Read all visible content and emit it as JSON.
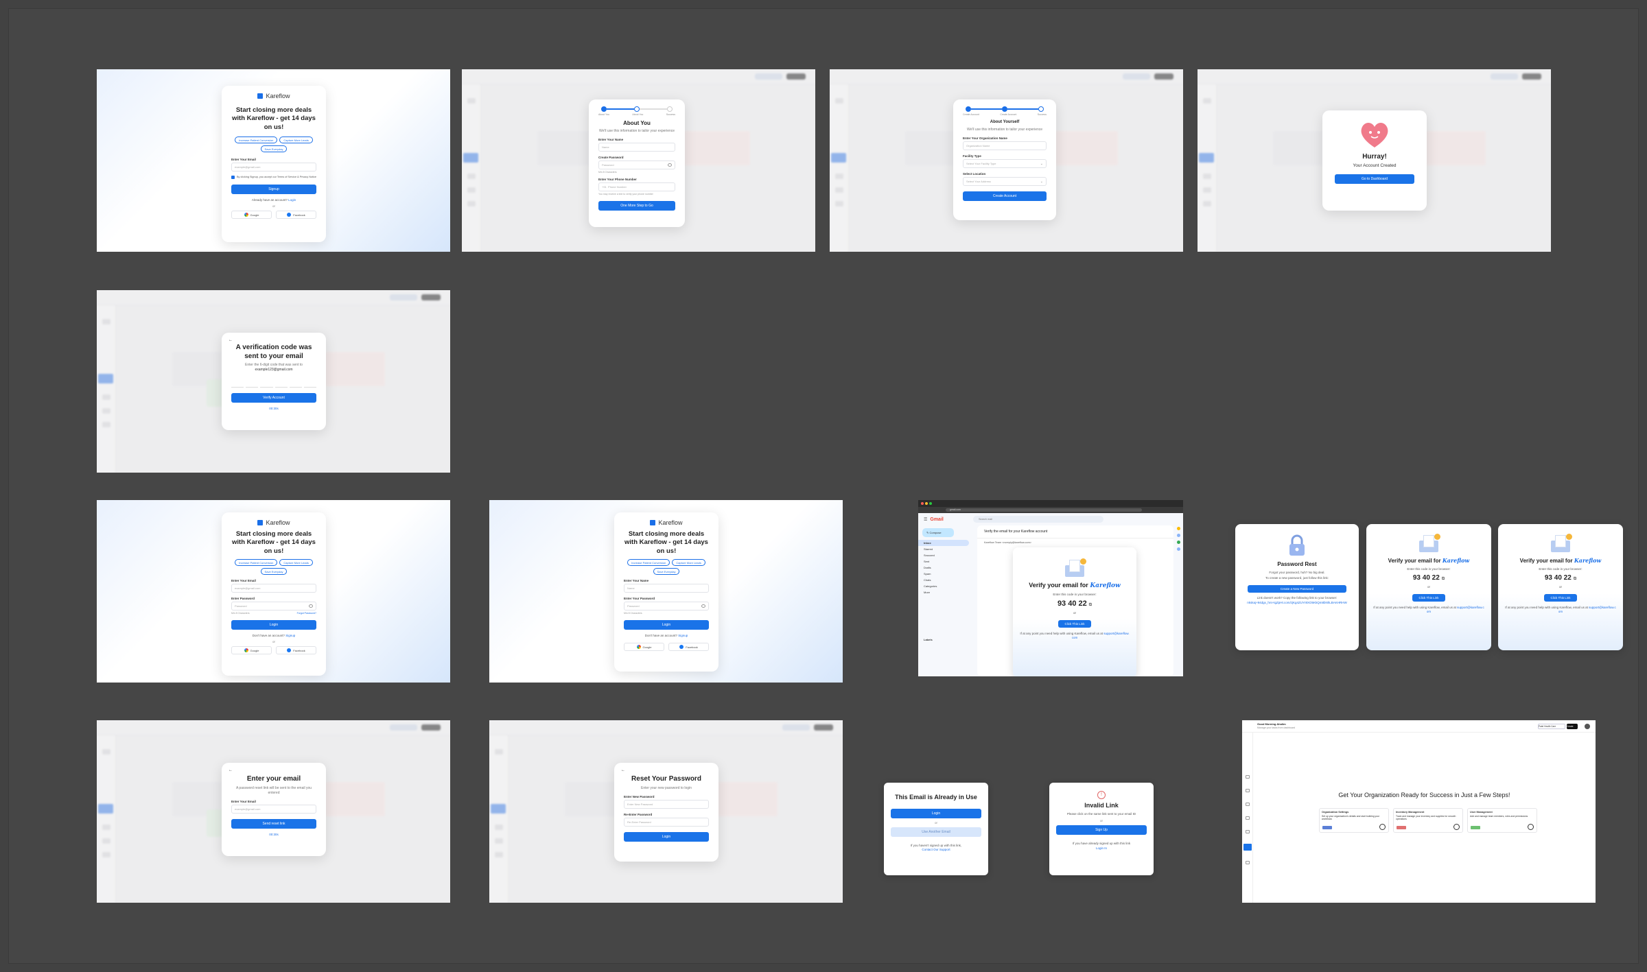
{
  "signup": {
    "brand": "Kareflow",
    "title": "Start closing more deals with Kareflow - get 14 days on us!",
    "chips": [
      "Increase Patient Conversion",
      "Capture More Leads",
      "Save Everyday"
    ],
    "email_label": "Enter Your Email",
    "email_placeholder": "example@gmail.com",
    "terms": "By clicking Signup, you accept our Terms of Service & Privacy Notice",
    "button": "Signup",
    "have_account": "Already have an account?",
    "login_link": "Login",
    "or": "or",
    "google": "Google",
    "facebook": "Facebook"
  },
  "about_you": {
    "steps": [
      "About You",
      "About You",
      "Success"
    ],
    "title": "About You",
    "subtitle": "We'll use this information to tailor your experience",
    "name_label": "Enter Your Name",
    "name_placeholder": "Name",
    "password_label": "Create Password",
    "password_placeholder": "Password",
    "password_hint": "Min 8 Characters",
    "phone_label": "Enter Your Phone Number",
    "phone_code": "+91",
    "phone_placeholder": "Phone Number",
    "phone_hint": "You may receive a text to verify your phone number",
    "button": "One More Step to Go"
  },
  "about_org": {
    "steps": [
      "Create Account",
      "Create Account",
      "Success"
    ],
    "title": "About Yourself",
    "subtitle": "We'll use this information to tailor your experience",
    "org_label": "Enter Your Organization Name",
    "org_placeholder": "Organization Name",
    "type_label": "Facility Type",
    "type_placeholder": "Select Your Facility Type",
    "location_label": "Select Location",
    "location_placeholder": "Select Your Address",
    "button": "Create Account"
  },
  "success": {
    "title": "Hurray!",
    "subtitle": "Your Account Created",
    "button": "Go to Dashboard"
  },
  "verify_code": {
    "title": "A verification code was sent to your email",
    "subtitle": "Enter the 6-digit code that was sent to",
    "email": "example123@gmail.com",
    "button": "Verify Account",
    "timer": "00:30s"
  },
  "login": {
    "brand": "Kareflow",
    "title": "Start closing more deals with Kareflow - get 14 days on us!",
    "chips": [
      "Increase Patient Conversion",
      "Capture More Leads",
      "Save Everyday"
    ],
    "email_label": "Enter Your Email",
    "email_placeholder": "example@gmail.com",
    "password_label": "Enter Password",
    "password_placeholder": "Password",
    "password_hint": "Min 8 Characters",
    "forgot": "Forgot Password?",
    "button": "Login",
    "no_account": "Don't have an account?",
    "signup_link": "Signup",
    "or": "or",
    "google": "Google",
    "facebook": "Facebook"
  },
  "login2": {
    "brand": "Kareflow",
    "title": "Start closing more deals with Kareflow - get 14 days on us!",
    "chips": [
      "Increase Patient Conversion",
      "Capture More Leads",
      "Save Everyday"
    ],
    "name_label": "Enter Your Name",
    "name_placeholder": "Name",
    "password_label": "Enter Your Password",
    "password_placeholder": "Password",
    "password_hint": "Min 8 Characters",
    "button": "Login",
    "no_account": "Don't have an account?",
    "signup_link": "Signup",
    "google": "Google",
    "facebook": "Facebook"
  },
  "gmail": {
    "url": "gmail.com",
    "logo": "Gmail",
    "search": "Search mail",
    "compose": "Compose",
    "folders": [
      "Inbox",
      "Starred",
      "Snoozed",
      "Sent",
      "Drafts",
      "Spam",
      "Chats",
      "Categories",
      "More"
    ],
    "labels_heading": "Labels",
    "subject": "Verify the email for your Kareflow account",
    "from": "Kareflow Team <noreply@kareflow.com>",
    "email_title": "Verify your email for",
    "brand": "Kareflow",
    "code_intro": "Enter this code in your browser:",
    "code": "93 40 22",
    "or": "or",
    "button": "Click This Link",
    "help": "If at any point you need help with using Kareflow, email us at",
    "support": "support@kareflow.com"
  },
  "password_reset_email": {
    "title": "Password Rest",
    "line1": "Forgot your password, huh? No big deal.",
    "line2": "To create a new password, just follow this link:",
    "button": "Create a New Password",
    "copy_hint": "Link doesn't work? Copy the following link to your browser:",
    "link": "nkskaj+94dgx_hrs+tgZpHt.com/zjKg4ZUYr8XO5KkQm8bNhLBAKHRHW"
  },
  "verify_email_1": {
    "title": "Verify your email for",
    "brand": "Kareflow",
    "code_intro": "Enter this code in your browser:",
    "code": "93 40 22",
    "or": "or",
    "button": "Click This Link",
    "help": "If at any point you need help with using Kareflow, email us at",
    "support": "support@kareflow.com"
  },
  "verify_email_2": {
    "title": "Verify your email for",
    "brand": "Kareflow",
    "code_intro": "Enter this code in your browser:",
    "code": "93 40 22",
    "or": "or",
    "button": "Click This Link",
    "help": "If at any point you need help with using Kareflow, email us at",
    "support": "support@kareflow.com"
  },
  "enter_email": {
    "title": "Enter your email",
    "subtitle": "A password reset link will be sent to the email you entered",
    "label": "Enter Your Email",
    "placeholder": "example@gmail.com",
    "button": "Send reset link",
    "timer": "00:30s"
  },
  "reset_password": {
    "title": "Reset Your Password",
    "subtitle": "Enter your new password to login",
    "new_label": "Enter New Password",
    "new_placeholder": "Enter New Password",
    "confirm_label": "Re-Enter Password",
    "confirm_placeholder": "Re-Enter Password",
    "button": "Login"
  },
  "email_in_use": {
    "title": "This Email is Already in Use",
    "button": "Login",
    "or": "or",
    "secondary": "Use Another Email",
    "note": "If you haven't signed up with this link,",
    "link": "Contact Our Support"
  },
  "invalid_link": {
    "title": "Invalid Link",
    "text": "Please click on the same link sent to your email ID",
    "or": "or",
    "button": "Sign Up",
    "note": "If you have already signed up with this link",
    "link": "Login In"
  },
  "dashboard": {
    "greeting": "Good Morning Ahalim",
    "subgreeting": "Manage your tasks from dashboard",
    "org_button": "Patel Health Care",
    "action_button": "Create",
    "title": "Get Your Organization Ready for Success in Just a Few Steps!",
    "cards": [
      {
        "title": "Organization Settings",
        "text": "Set up your organization's details and start building your workflows",
        "color": "#5b7fd6"
      },
      {
        "title": "Inventory Management",
        "text": "Track and manage your inventory and supplies for smooth operations",
        "color": "#e07070"
      },
      {
        "title": "User Management",
        "text": "Add and manage team members, roles and permissions",
        "color": "#6cc070"
      }
    ]
  }
}
